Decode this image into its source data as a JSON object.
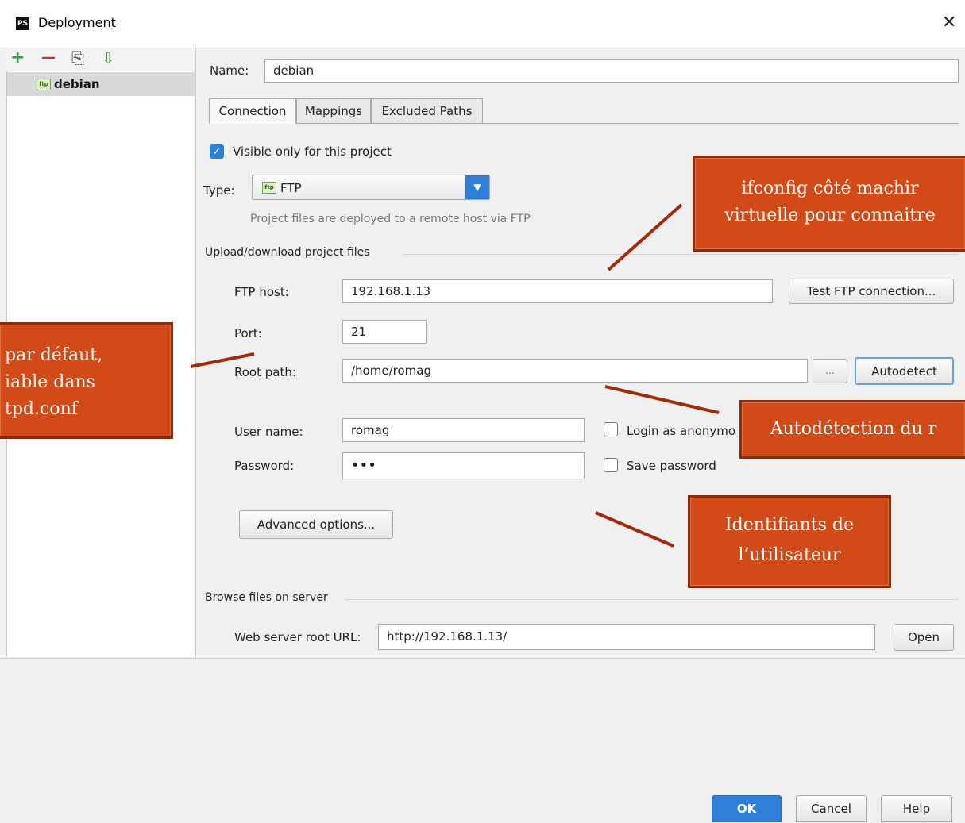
{
  "window": {
    "title": "Deployment",
    "logo_text": "PS",
    "close_glyph": "✕"
  },
  "toolbar": {
    "add": "+",
    "remove": "—",
    "copy": "⎘",
    "import": "⇩"
  },
  "tree": {
    "badge": "ftp",
    "item": "debian"
  },
  "name": {
    "label": "Name:",
    "value": "debian"
  },
  "tabs": [
    {
      "label": "Connection",
      "active": true
    },
    {
      "label": "Mappings"
    },
    {
      "label": "Excluded Paths"
    }
  ],
  "visible_only": {
    "label": "Visible only for this project",
    "checked": true
  },
  "type": {
    "label": "Type:",
    "badge": "ftp",
    "value": "FTP",
    "hint": "Project files are deployed to a remote host via FTP"
  },
  "upload_section": {
    "title": "Upload/download project files"
  },
  "ftp_host": {
    "label": "FTP host:",
    "value": "192.168.1.13",
    "button": "Test FTP connection..."
  },
  "port": {
    "label": "Port:",
    "value": "21"
  },
  "root_path": {
    "label": "Root path:",
    "value": "/home/romag",
    "browse": "...",
    "button": "Autodetect"
  },
  "user_name": {
    "label": "User name:",
    "value": "romag"
  },
  "login_anon": {
    "label": "Login as anonymo"
  },
  "password": {
    "label": "Password:",
    "value": "•••"
  },
  "save_password": {
    "label": "Save password"
  },
  "advanced": {
    "button": "Advanced options..."
  },
  "browse_section": {
    "title": "Browse files on server"
  },
  "web_url": {
    "label": "Web server root URL:",
    "value": "http://192.168.1.13/",
    "button": "Open"
  },
  "footer": {
    "ok": "OK",
    "cancel": "Cancel",
    "help": "Help"
  },
  "notes": {
    "ifconfig_line1": "ifconfig côté machir",
    "ifconfig_line2": "virtuelle pour connaitre",
    "port_line1": "par défaut,",
    "port_line2": "iable dans",
    "port_line3": "tpd.conf",
    "autodetect": "Autodétection du r",
    "ident_line1": "Identifiants de",
    "ident_line2": "l’utilisateur"
  },
  "colors": {
    "accent": "#2f7fd9",
    "note_bg": "#d24a17",
    "note_line": "#a02a0a",
    "add_green": "#3a9a3a",
    "remove_red": "#cc3333"
  }
}
